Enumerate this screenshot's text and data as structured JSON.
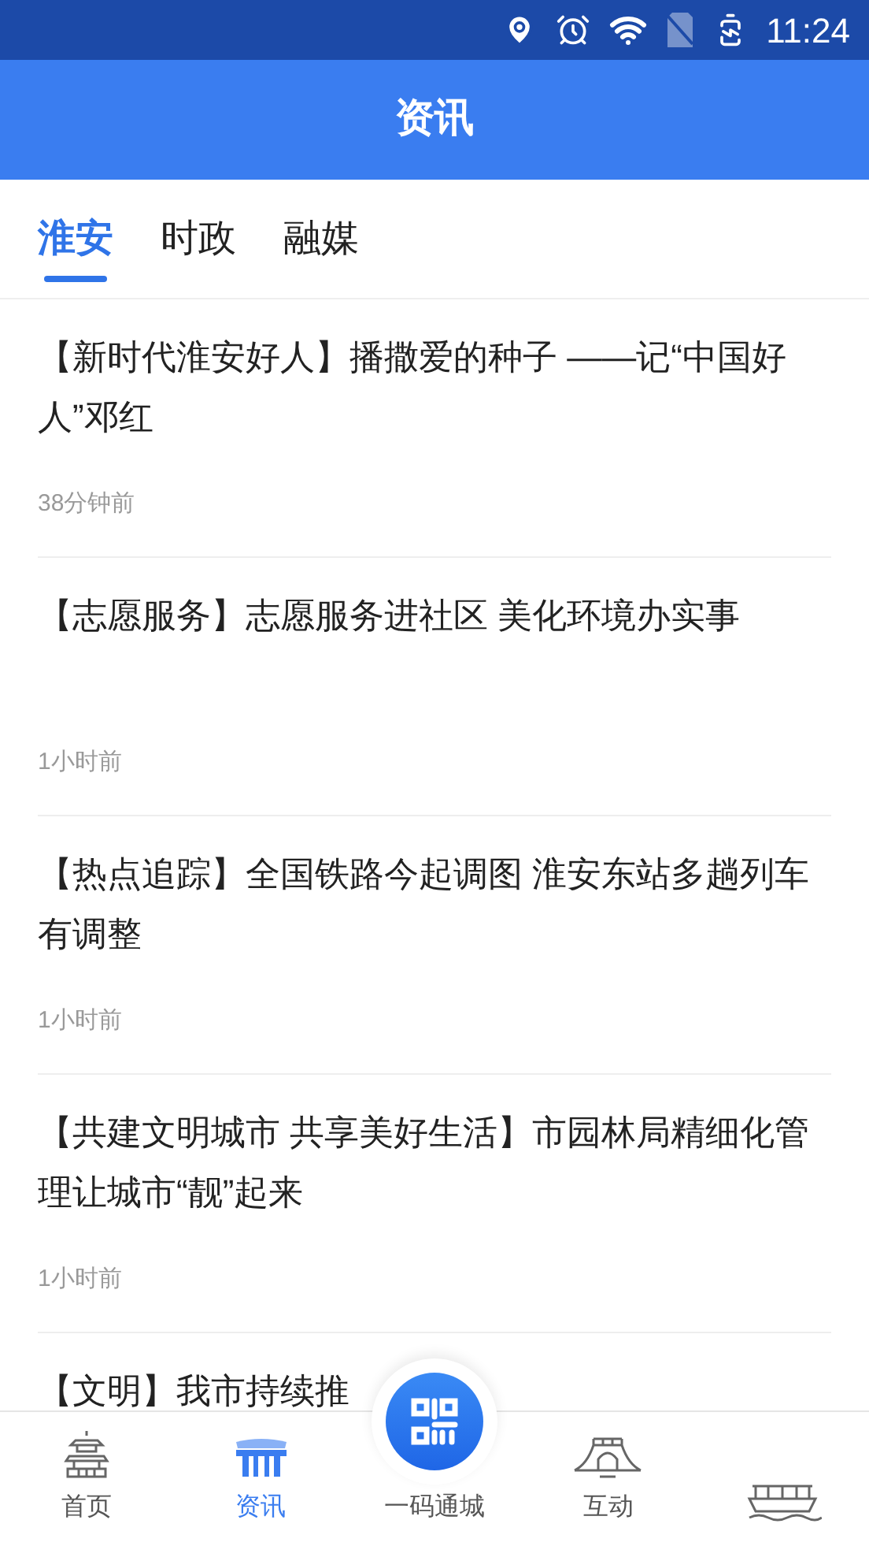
{
  "status_bar": {
    "time": "11:24"
  },
  "header": {
    "title": "资讯"
  },
  "tabs": [
    {
      "label": "淮安",
      "selected": true
    },
    {
      "label": "时政",
      "selected": false
    },
    {
      "label": "融媒",
      "selected": false
    }
  ],
  "news": [
    {
      "title": "【新时代淮安好人】播撒爱的种子 ——记“中国好人”邓红",
      "time": "38分钟前"
    },
    {
      "title": "【志愿服务】志愿服务进社区 美化环境办实事",
      "time": "1小时前"
    },
    {
      "title": "【热点追踪】全国铁路今起调图 淮安东站多趟列车有调整",
      "time": "1小时前"
    },
    {
      "title": "【共建文明城市 共享美好生活】市园林局精细化管理让城市“靓”起来",
      "time": "1小时前"
    },
    {
      "title": "【文明】我市持续推"
    }
  ],
  "bottom_nav": [
    {
      "kind": "pagoda",
      "label": "首页",
      "selected": false
    },
    {
      "kind": "gate",
      "label": "资讯",
      "selected": true
    },
    {
      "kind": "qr",
      "label": "一码通城",
      "selected": false
    },
    {
      "kind": "bridge",
      "label": "互动",
      "selected": false
    },
    {
      "kind": "boat",
      "selected": false
    }
  ]
}
